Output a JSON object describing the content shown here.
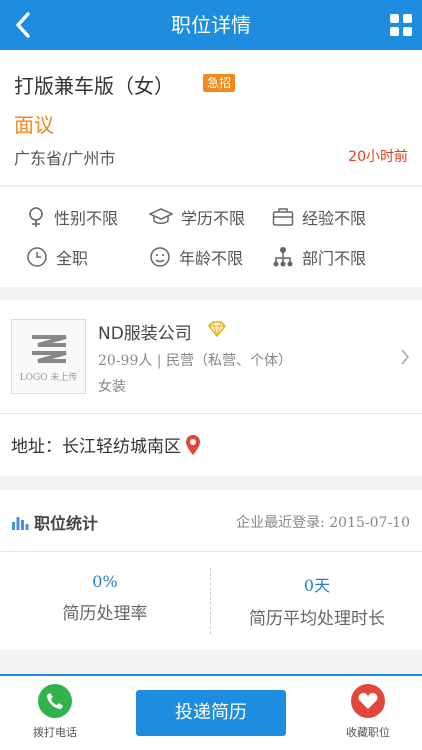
{
  "topbar": {
    "title": "职位详情"
  },
  "job": {
    "title": "打版兼车版（女）",
    "badge": "急招",
    "salary": "面议",
    "location": "广东省/广州市",
    "posted": "20小时前"
  },
  "requirements": [
    {
      "icon": "gender-icon",
      "label": "性别不限"
    },
    {
      "icon": "education-icon",
      "label": "学历不限"
    },
    {
      "icon": "experience-icon",
      "label": "经验不限"
    },
    {
      "icon": "clock-icon",
      "label": "全职"
    },
    {
      "icon": "age-icon",
      "label": "年龄不限"
    },
    {
      "icon": "department-icon",
      "label": "部门不限"
    }
  ],
  "company": {
    "logo_caption": "LOGO 未上传",
    "name": "ND服装公司",
    "meta": "20-99人 | 民营（私营、个体）",
    "industry": "女装",
    "address": "地址：长江轻纺城南区"
  },
  "stats": {
    "title": "职位统计",
    "last_login": "企业最近登录: 2015-07-10",
    "items": [
      {
        "value": "0%",
        "label": "简历处理率"
      },
      {
        "value": "0天",
        "label": "简历平均处理时长"
      }
    ]
  },
  "bottom": {
    "call_label": "拨打电话",
    "apply_label": "投递简历",
    "favorite_label": "收藏职位"
  },
  "colors": {
    "primary": "#1f8ddf",
    "accent_orange": "#f08a1c",
    "time_red": "#e2421b",
    "call_green": "#2fb34a",
    "favorite_red": "#e2473b"
  }
}
